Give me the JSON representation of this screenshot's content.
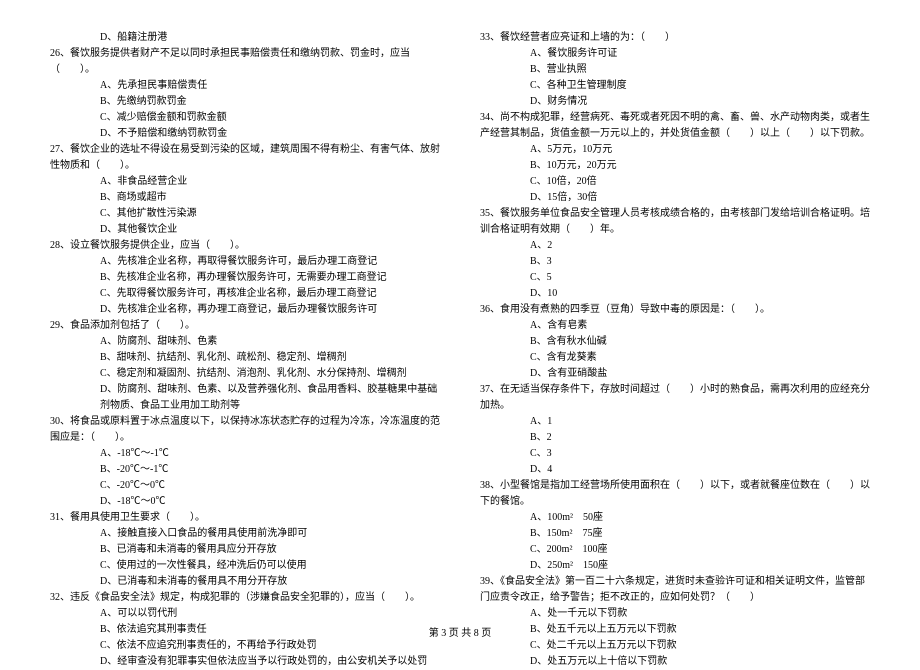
{
  "left": {
    "q25_d": "D、船籍注册港",
    "q26": "26、餐饮服务提供者财产不足以同时承担民事赔偿责任和缴纳罚款、罚金时，应当（　　）。",
    "q26_a": "A、先承担民事赔偿责任",
    "q26_b": "B、先缴纳罚款罚金",
    "q26_c": "C、减少赔偿金额和罚款金额",
    "q26_d": "D、不予赔偿和缴纳罚款罚金",
    "q27": "27、餐饮企业的选址不得设在易受到污染的区域，建筑周围不得有粉尘、有害气体、放射性物质和（　　）。",
    "q27_a": "A、非食品经营企业",
    "q27_b": "B、商场或超市",
    "q27_c": "C、其他扩散性污染源",
    "q27_d": "D、其他餐饮企业",
    "q28": "28、设立餐饮服务提供企业，应当（　　）。",
    "q28_a": "A、先核准企业名称，再取得餐饮服务许可，最后办理工商登记",
    "q28_b": "B、先核准企业名称，再办理餐饮服务许可，无需要办理工商登记",
    "q28_c": "C、先取得餐饮服务许可，再核准企业名称，最后办理工商登记",
    "q28_d": "D、先核准企业名称，再办理工商登记，最后办理餐饮服务许可",
    "q29": "29、食品添加剂包括了（　　）。",
    "q29_a": "A、防腐剂、甜味剂、色素",
    "q29_b": "B、甜味剂、抗结剂、乳化剂、疏松剂、稳定剂、增稠剂",
    "q29_c": "C、稳定剂和凝固剂、抗结剂、消泡剂、乳化剂、水分保持剂、增稠剂",
    "q29_d": "D、防腐剂、甜味剂、色素、以及营养强化剂、食品用香料、胶基糖果中基础剂物质、食品工业用加工助剂等",
    "q30": "30、将食品或原料置于冰点温度以下，以保持冰冻状态贮存的过程为冷冻，冷冻温度的范围应是：（　　）。",
    "q30_a": "A、-18℃～-1℃",
    "q30_b": "B、-20℃～-1℃",
    "q30_c": "C、-20℃～0℃",
    "q30_d": "D、-18℃～0℃",
    "q31": "31、餐用具使用卫生要求（　　）。",
    "q31_a": "A、接触直接入口食品的餐用具使用前洗净即可",
    "q31_b": "B、已消毒和未消毒的餐用具应分开存放",
    "q31_c": "C、使用过的一次性餐具，经冲洗后仍可以使用",
    "q31_d": "D、已消毒和未消毒的餐用具不用分开存放",
    "q32": "32、违反《食品安全法》规定，构成犯罪的（涉嫌食品安全犯罪的），应当（　　）。",
    "q32_a": "A、可以以罚代刑",
    "q32_b": "B、依法追究其刑事责任",
    "q32_c": "C、依法不应追究刑事责任的，不再给予行政处罚",
    "q32_d": "D、经审查没有犯罪事实但依法应当予以行政处罚的，由公安机关予以处罚"
  },
  "right": {
    "q33": "33、餐饮经营者应亮证和上墙的为：（　　）",
    "q33_a": "A、餐饮服务许可证",
    "q33_b": "B、营业执照",
    "q33_c": "C、各种卫生管理制度",
    "q33_d": "D、财务情况",
    "q34": "34、尚不构成犯罪，经营病死、毒死或者死因不明的禽、畜、兽、水产动物肉类，或者生产经营其制品，货值金额一万元以上的，并处货值金额（　　）以上（　　）以下罚款。",
    "q34_a": "A、5万元，10万元",
    "q34_b": "B、10万元，20万元",
    "q34_c": "C、10倍，20倍",
    "q34_d": "D、15倍，30倍",
    "q35": "35、餐饮服务单位食品安全管理人员考核成绩合格的，由考核部门发给培训合格证明。培训合格证明有效期（　　）年。",
    "q35_a": "A、2",
    "q35_b": "B、3",
    "q35_c": "C、5",
    "q35_d": "D、10",
    "q36": "36、食用没有煮熟的四季豆（豆角）导致中毒的原因是：（　　）。",
    "q36_a": "A、含有皂素",
    "q36_b": "B、含有秋水仙碱",
    "q36_c": "C、含有龙葵素",
    "q36_d": "D、含有亚硝酸盐",
    "q37": "37、在无适当保存条件下，存放时间超过（　　）小时的熟食品，需再次利用的应经充分加热。",
    "q37_a": "A、1",
    "q37_b": "B、2",
    "q37_c": "C、3",
    "q37_d": "D、4",
    "q38": "38、小型餐馆是指加工经营场所使用面积在（　　）以下，或者就餐座位数在（　　）以下的餐馆。",
    "q38_a": "A、100m²　50座",
    "q38_b": "B、150m²　75座",
    "q38_c": "C、200m²　100座",
    "q38_d": "D、250m²　150座",
    "q39": "39、《食品安全法》第一百二十六条规定，进货时未查验许可证和相关证明文件，监管部门应责令改正，给予警告；拒不改正的，应如何处罚？（　　）",
    "q39_a": "A、处一千元以下罚款",
    "q39_b": "B、处五千元以上五万元以下罚款",
    "q39_c": "C、处二千元以上五万元以下罚款",
    "q39_d": "D、处五万元以上十倍以下罚款"
  },
  "footer": "第 3 页 共 8 页"
}
